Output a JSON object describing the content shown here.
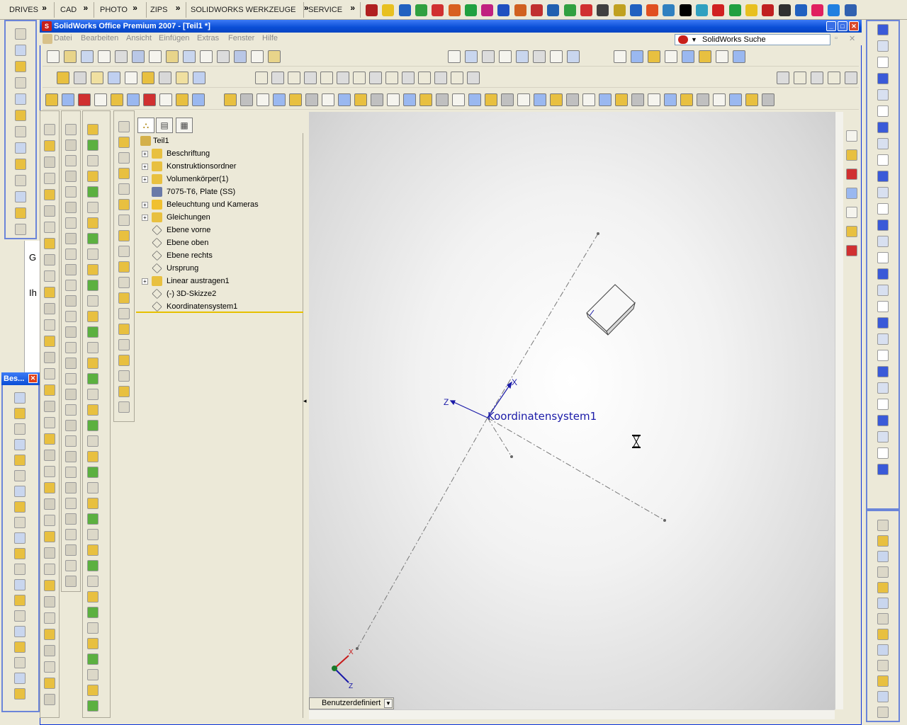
{
  "launcher": {
    "menus": [
      "DRIVES",
      "CAD",
      "PHOTO",
      "ZIPS",
      "SOLIDWORKS WERKZEUGE",
      "SERVICE"
    ]
  },
  "window": {
    "title": "SolidWorks Office Premium 2007 - [Teil1 *]"
  },
  "menubar": {
    "items": [
      "Datei",
      "Bearbeiten",
      "Ansicht",
      "Einfügen",
      "Extras",
      "Fenster",
      "Hilfe"
    ]
  },
  "search": {
    "label": "SolidWorks Suche"
  },
  "tree": {
    "root": "Teil1",
    "items": [
      {
        "label": "Beschriftung",
        "expandable": true,
        "icon": "annotation-icon"
      },
      {
        "label": "Konstruktionsordner",
        "expandable": true,
        "icon": "design-folder-icon"
      },
      {
        "label": "Volumenkörper(1)",
        "expandable": true,
        "icon": "solid-bodies-icon"
      },
      {
        "label": "7075-T6, Plate (SS)",
        "expandable": false,
        "icon": "material-icon"
      },
      {
        "label": "Beleuchtung und Kameras",
        "expandable": true,
        "icon": "lights-icon"
      },
      {
        "label": "Gleichungen",
        "expandable": true,
        "icon": "equations-icon"
      },
      {
        "label": "Ebene vorne",
        "expandable": false,
        "icon": "plane-icon"
      },
      {
        "label": "Ebene oben",
        "expandable": false,
        "icon": "plane-icon"
      },
      {
        "label": "Ebene rechts",
        "expandable": false,
        "icon": "plane-icon"
      },
      {
        "label": "Ursprung",
        "expandable": false,
        "icon": "origin-icon"
      },
      {
        "label": "Linear austragen1",
        "expandable": true,
        "icon": "extrude-icon"
      },
      {
        "label": "(-) 3D-Skizze2",
        "expandable": false,
        "icon": "sketch3d-icon"
      },
      {
        "label": "Koordinatensystem1",
        "expandable": false,
        "icon": "coordinate-system-icon"
      }
    ]
  },
  "graphics": {
    "cs_label": "Koordinatensystem1",
    "axis_x": "X",
    "axis_z": "Z",
    "triad_x": "X",
    "triad_z": "Z"
  },
  "view": {
    "selector": "Benutzerdefiniert"
  },
  "floating": {
    "title": "Bes..."
  },
  "bgdoc": {
    "letter_g": "G",
    "letters_ih": "Ih"
  },
  "colors": {
    "title_blue": "#0a4ed6",
    "toolbar_bg": "#ece9d8",
    "cs_blue": "#1a1aa8"
  }
}
